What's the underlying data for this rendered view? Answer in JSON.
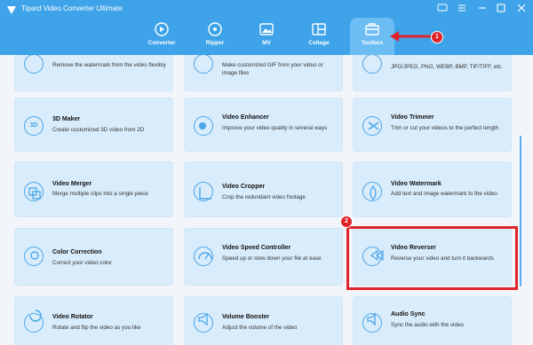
{
  "app": {
    "title": "Tipard Video Converter Ultimate"
  },
  "nav": [
    {
      "label": "Converter",
      "icon": "converter-icon"
    },
    {
      "label": "Ripper",
      "icon": "ripper-icon"
    },
    {
      "label": "MV",
      "icon": "mv-icon"
    },
    {
      "label": "Collage",
      "icon": "collage-icon"
    },
    {
      "label": "Toolbox",
      "icon": "toolbox-icon",
      "active": true
    }
  ],
  "tools": {
    "r0c0": {
      "title": "",
      "desc": "Remove the watermark from the video flexibly"
    },
    "r0c1": {
      "title": "",
      "desc": "Make customized GIF from your video or image files"
    },
    "r0c2": {
      "title": "",
      "desc": "JPG/JPEG, PNG, WEBP, BMP, TIF/TIFF, etc."
    },
    "r1c0": {
      "title": "3D Maker",
      "desc": "Create customized 3D video from 2D"
    },
    "r1c1": {
      "title": "Video Enhancer",
      "desc": "Improve your video quality in several ways"
    },
    "r1c2": {
      "title": "Video Trimmer",
      "desc": "Trim or cut your videos to the perfect length"
    },
    "r2c0": {
      "title": "Video Merger",
      "desc": "Merge multiple clips into a single piece"
    },
    "r2c1": {
      "title": "Video Cropper",
      "desc": "Crop the redundant video footage"
    },
    "r2c2": {
      "title": "Video Watermark",
      "desc": "Add text and image watermark to the video"
    },
    "r3c0": {
      "title": "Color Correction",
      "desc": "Correct your video color"
    },
    "r3c1": {
      "title": "Video Speed Controller",
      "desc": "Speed up or slow down your file at ease"
    },
    "r3c2": {
      "title": "Video Reverser",
      "desc": "Reverse your video and turn it backwards"
    },
    "r4c0": {
      "title": "Video Rotator",
      "desc": "Rotate and flip the video as you like"
    },
    "r4c1": {
      "title": "Volume Booster",
      "desc": "Adjust the volume of the video"
    },
    "r4c2": {
      "title": "Audio Sync",
      "desc": "Sync the audio with the video"
    }
  },
  "annotations": {
    "step1": "1",
    "step2": "2",
    "highlight_color": "#e0242b"
  },
  "colors": {
    "titlebar": "#3ea3e8",
    "accent": "#4aa6e9",
    "card": "#d9ecfb"
  }
}
